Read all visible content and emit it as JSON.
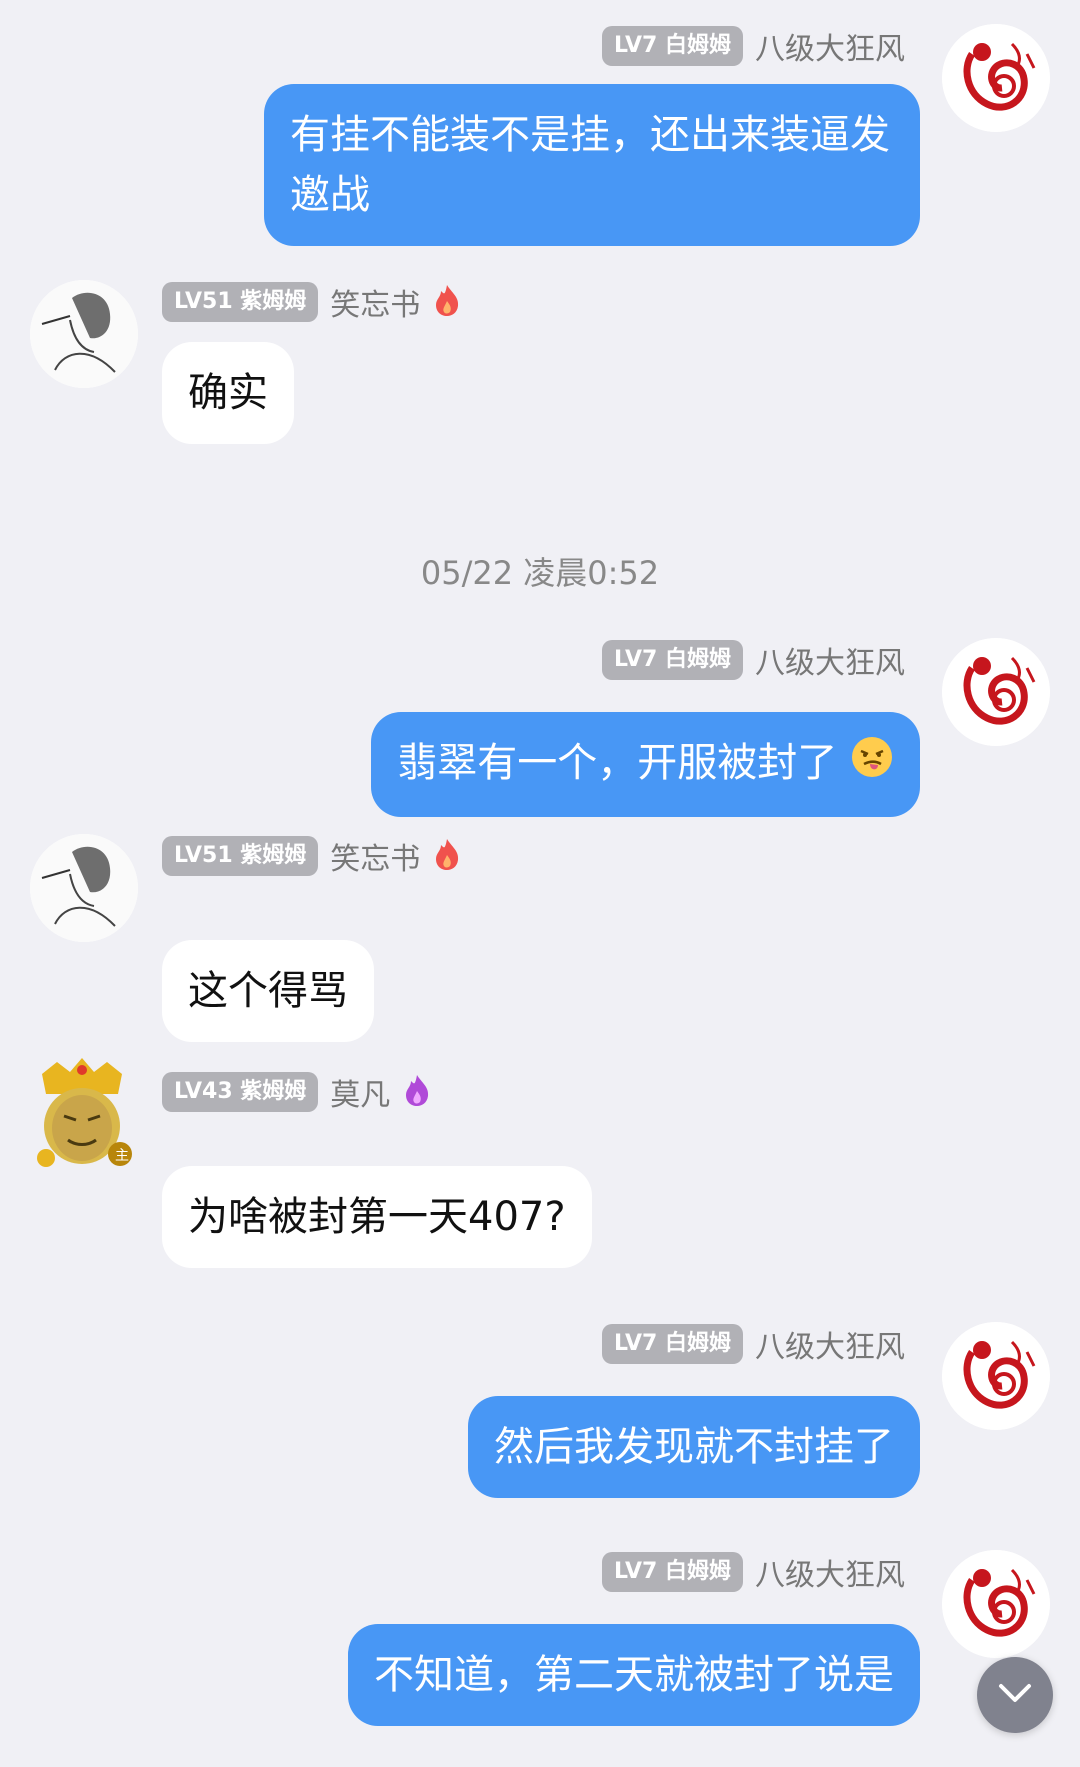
{
  "messages": [
    {
      "side": "out",
      "badge": "LV7 白姆姆",
      "name": "八级大狂风",
      "text": "有挂不能装不是挂，还出来装逼发邀战",
      "avatar": "snake-papercut-avatar"
    },
    {
      "side": "in",
      "badge": "LV51 紫姆姆",
      "name": "笑忘书",
      "text": "确实",
      "avatar": "sketch-man-avatar",
      "icon": "flame-icon"
    },
    {
      "side": "out",
      "badge": "LV7 白姆姆",
      "name": "八级大狂风",
      "text": "翡翠有一个，开服被封了",
      "emoji": "tongue-out-emoji",
      "avatar": "snake-papercut-avatar"
    },
    {
      "side": "in",
      "badge": "LV51 紫姆姆",
      "name": "笑忘书",
      "text": "这个得骂",
      "avatar": "sketch-man-avatar",
      "icon": "flame-icon"
    },
    {
      "side": "in",
      "badge": "LV43 紫姆姆",
      "name": "莫凡",
      "text": "为啥被封第一天407?",
      "avatar": "golden-crown-face-avatar",
      "icon": "purple-flame-icon"
    },
    {
      "side": "out",
      "badge": "LV7 白姆姆",
      "name": "八级大狂风",
      "text": "然后我发现就不封挂了",
      "avatar": "snake-papercut-avatar"
    },
    {
      "side": "out",
      "badge": "LV7 白姆姆",
      "name": "八级大狂风",
      "text": "不知道，第二天就被封了说是",
      "avatar": "snake-papercut-avatar"
    }
  ],
  "timestamp": "05/22 凌晨0:52",
  "colors": {
    "outgoing_bubble": "#4897f5",
    "incoming_bubble": "#ffffff",
    "background": "#f0f0f5",
    "badge": "#b1b1b6"
  },
  "scroll_button_icon": "chevron-down-icon"
}
